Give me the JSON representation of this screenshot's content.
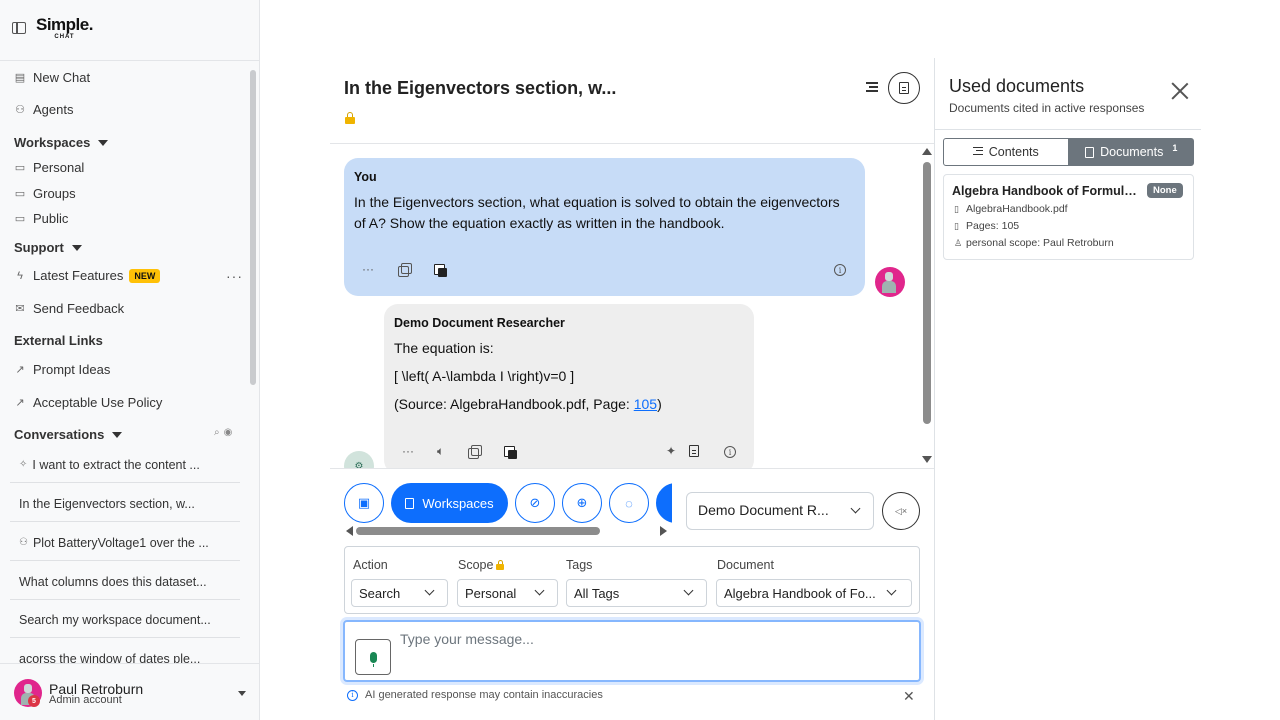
{
  "brand": {
    "name": "Simple.",
    "sub": "CHAT"
  },
  "sidebar": {
    "new_chat": "New Chat",
    "agents": "Agents",
    "workspaces_header": "Workspaces",
    "workspaces": [
      "Personal",
      "Groups",
      "Public"
    ],
    "support_header": "Support",
    "latest_features": "Latest Features",
    "new_badge": "NEW",
    "send_feedback": "Send Feedback",
    "external_header": "External Links",
    "prompt_ideas": "Prompt Ideas",
    "acceptable_use": "Acceptable Use Policy",
    "conversations_header": "Conversations",
    "conversations": [
      "I want to extract the content ...",
      "In the Eigenvectors section, w...",
      "Plot BatteryVoltage1 over the ...",
      "What columns does this dataset...",
      "Search my workspace document...",
      "acorss the window of dates ple..."
    ]
  },
  "user": {
    "name": "Paul Retroburn",
    "role": "Admin account",
    "badge": "5"
  },
  "chat": {
    "title": "In the Eigenvectors section, w...",
    "messages": {
      "user": {
        "sender": "You",
        "text": "In the Eigenvectors section, what equation is solved to obtain the eigenvectors of A? Show the equation exactly as written in the handbook."
      },
      "ai": {
        "sender": "Demo Document Researcher",
        "line1": "The equation is:",
        "line2": "[ \\left( A-\\lambda I \\right)v=0 ]",
        "source_prefix": "(Source: AlgebraHandbook.pdf, Page: ",
        "source_page": "105",
        "source_suffix": ")"
      }
    },
    "workspaces_button": "Workspaces",
    "agent_select": "Demo Document R...",
    "filters": {
      "action_label": "Action",
      "action_value": "Search",
      "scope_label": "Scope",
      "scope_value": "Personal",
      "tags_label": "Tags",
      "tags_value": "All Tags",
      "document_label": "Document",
      "document_value": "Algebra Handbook of Fo..."
    },
    "composer_placeholder": "Type your message...",
    "disclaimer": "AI generated response may contain inaccuracies"
  },
  "panel": {
    "title": "Used documents",
    "subtitle": "Documents cited in active responses",
    "tab_contents": "Contents",
    "tab_documents": "Documents",
    "documents_count": "1",
    "doc": {
      "title": "Algebra Handbook of Formulas,...",
      "badge": "None",
      "file": "AlgebraHandbook.pdf",
      "pages": "Pages: 105",
      "scope": "personal scope: Paul Retroburn"
    }
  },
  "colors": {
    "accent": "#0d6efd",
    "user_bubble": "#c7dcf7",
    "ai_bubble": "#eeeeee",
    "new_badge": "#ffc107"
  }
}
